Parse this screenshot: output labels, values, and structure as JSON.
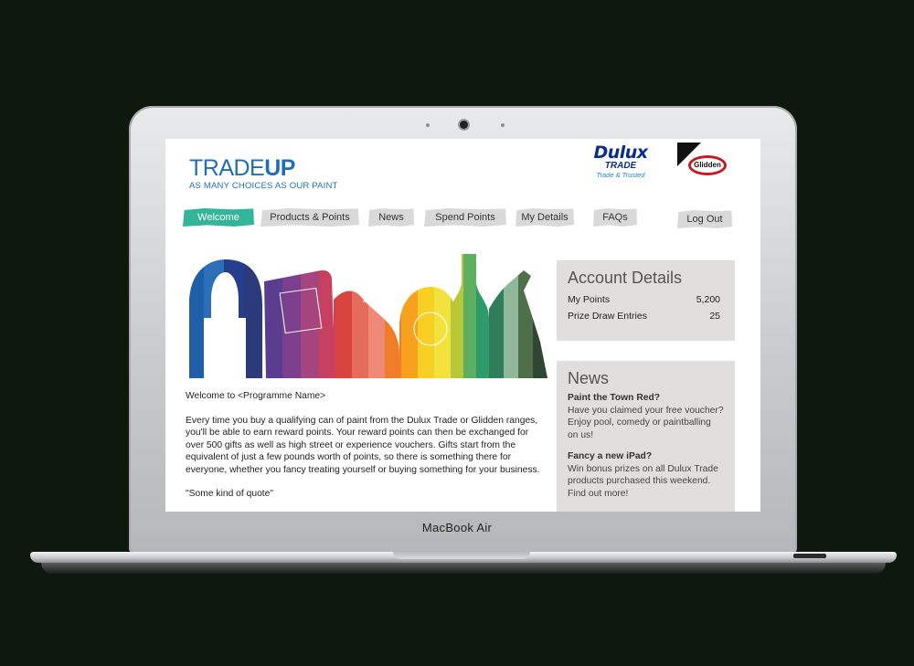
{
  "device": {
    "brand_label": "MacBook Air"
  },
  "header": {
    "logo_word1": "TRADE",
    "logo_word2": "UP",
    "logo_tagline": "AS MANY CHOICES AS OUR PAINT",
    "dulux_name": "Dulux",
    "dulux_sub": "TRADE",
    "dulux_tag": "Trade & Trusted",
    "glidden_name": "Glidden"
  },
  "nav": {
    "items": [
      {
        "label": "Welcome",
        "active": true
      },
      {
        "label": "Products & Points"
      },
      {
        "label": "News"
      },
      {
        "label": "Spend Points"
      },
      {
        "label": "My Details"
      },
      {
        "label": "FAQs"
      }
    ],
    "logout_label": "Log Out"
  },
  "main": {
    "greeting": "Welcome to <Programme Name>",
    "body": "Every time you buy a qualifying can of paint from the Dulux Trade or Glidden ranges, you'll be able to earn reward points. Your reward points can then be exchanged for over 500 gifts as well as high street or experience vouchers. Gifts start from the equivalent of just a few pounds worth of points, so there is something there for everyone, whether you fancy treating yourself or buying something for your business.",
    "quote": "\"Some kind of quote\""
  },
  "account": {
    "title": "Account Details",
    "rows": [
      {
        "label": "My Points",
        "value": "5,200"
      },
      {
        "label": "Prize Draw Entries",
        "value": "25"
      }
    ]
  },
  "news": {
    "title": "News",
    "items": [
      {
        "headline": "Paint the Town Red?",
        "text": "Have you claimed your free voucher? Enjoy pool, comedy or paintballing on us!"
      },
      {
        "headline": "Fancy a new iPad?",
        "text": "Win bonus prizes on all Dulux Trade products purchased this weekend. Find out more!"
      }
    ]
  },
  "colors": {
    "brand_blue": "#1f6fb5",
    "nav_active": "#33b59a",
    "nav_inactive": "#d9d9d9",
    "panel_bg": "#e1dfdd",
    "dulux_blue": "#0b2e88",
    "glidden_red": "#c8191e"
  },
  "icons": [
    "camera-icon",
    "headphones-icon",
    "tablet-icon",
    "shoe-icon",
    "bottle-icon",
    "golf-bag-icon"
  ]
}
